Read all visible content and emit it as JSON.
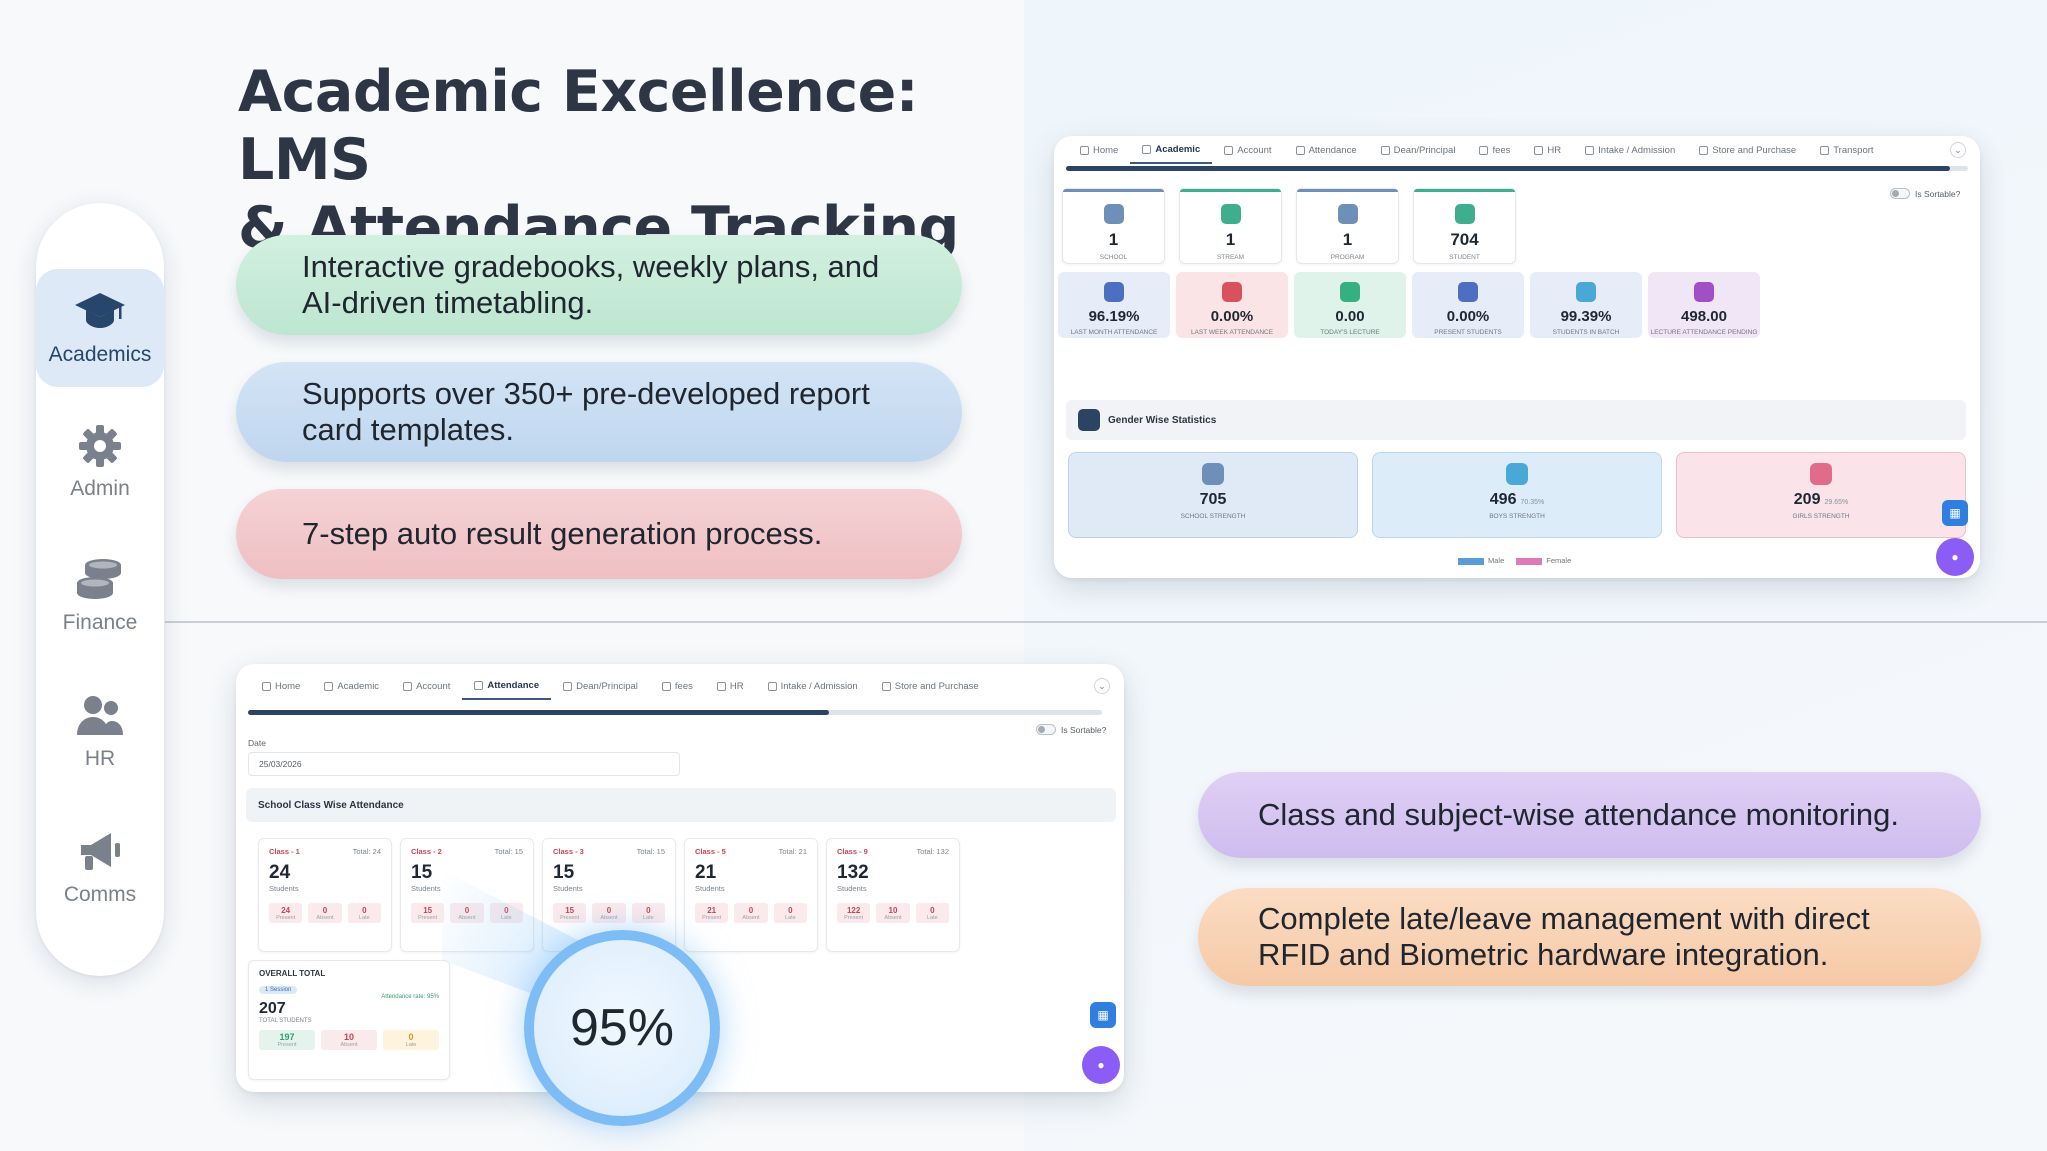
{
  "headline": {
    "line1": "Academic Excellence: LMS",
    "line2": "& Attendance Tracking"
  },
  "sidebar": {
    "items": [
      {
        "label": "Academics",
        "icon": "graduation-cap-icon",
        "active": true
      },
      {
        "label": "Admin",
        "icon": "gear-icon",
        "active": false
      },
      {
        "label": "Finance",
        "icon": "coins-icon",
        "active": false
      },
      {
        "label": "HR",
        "icon": "users-icon",
        "active": false
      },
      {
        "label": "Comms",
        "icon": "megaphone-icon",
        "active": false
      }
    ]
  },
  "features": {
    "gradebooks": {
      "line1": "Interactive gradebooks, weekly plans, and",
      "line2": "AI-driven timetabling."
    },
    "report_cards": {
      "line1": "Supports over 350+ pre-developed report",
      "line2": "card templates."
    },
    "results": "7-step auto result generation process.",
    "monitoring": "Class and subject-wise attendance monitoring.",
    "late_leave": {
      "line1": "Complete late/leave management with direct",
      "line2": "RFID and Biometric hardware integration."
    }
  },
  "dashboard": {
    "tabs": [
      "Home",
      "Academic",
      "Account",
      "Attendance",
      "Dean/Principal",
      "fees",
      "HR",
      "Intake / Admission",
      "Store and Purchase",
      "Transport"
    ],
    "active_tab": "Academic",
    "sortable_label": "Is Sortable?",
    "counts": [
      {
        "value": "1",
        "label": "School",
        "color": "#6d8fb8"
      },
      {
        "value": "1",
        "label": "Stream",
        "color": "#3fae8f"
      },
      {
        "value": "1",
        "label": "Program",
        "color": "#6d8fb8"
      },
      {
        "value": "704",
        "label": "Student",
        "color": "#3fae8f"
      }
    ],
    "stats": [
      {
        "value": "96.19%",
        "label": "Last Month Attendance",
        "bg": "#e6edf9",
        "icon_bg": "#4d6fc2"
      },
      {
        "value": "0.00%",
        "label": "Last Week Attendance",
        "bg": "#fbe4e5",
        "icon_bg": "#d8525b"
      },
      {
        "value": "0.00",
        "label": "Today's Lecture",
        "bg": "#dff3ea",
        "icon_bg": "#35b07f"
      },
      {
        "value": "0.00%",
        "label": "Present Students",
        "bg": "#e6edf9",
        "icon_bg": "#4d6fc2"
      },
      {
        "value": "99.39%",
        "label": "Students in Batch",
        "bg": "#e6edf9",
        "icon_bg": "#4aa8d6"
      },
      {
        "value": "498.00",
        "label": "Lecture Attendance Pending",
        "bg": "#f1e6f6",
        "icon_bg": "#a04fc4"
      }
    ],
    "gender_title": "Gender Wise Statistics",
    "gender": [
      {
        "value": "705",
        "suffix": "",
        "label": "School Strength",
        "bg": "#dfeaf6",
        "border": "#bdd3ec",
        "icon_bg": "#6d8fb8"
      },
      {
        "value": "496",
        "suffix": "70.35%",
        "label": "Boys Strength",
        "bg": "#dcecf8",
        "border": "#b8d9f0",
        "icon_bg": "#4aa8d6"
      },
      {
        "value": "209",
        "suffix": "29.65%",
        "label": "Girls Strength",
        "bg": "#fbe3ea",
        "border": "#f2bccb",
        "icon_bg": "#e06b8b"
      }
    ],
    "legend": [
      {
        "label": "Male",
        "color": "#5b9bd8"
      },
      {
        "label": "Female",
        "color": "#e07ab7"
      }
    ]
  },
  "attendance": {
    "tabs": [
      "Home",
      "Academic",
      "Account",
      "Attendance",
      "Dean/Principal",
      "fees",
      "HR",
      "Intake / Admission",
      "Store and Purchase"
    ],
    "active_tab": "Attendance",
    "sortable_label": "Is Sortable?",
    "date_label": "Date",
    "date_value": "25/03/2026",
    "section_title": "School Class Wise Attendance",
    "classes": [
      {
        "name": "Class - 1",
        "total": "Total: 24",
        "count": "24",
        "sub": "Students",
        "present": "24",
        "absent": "0",
        "late": "0"
      },
      {
        "name": "Class - 2",
        "total": "Total: 15",
        "count": "15",
        "sub": "Students",
        "present": "15",
        "absent": "0",
        "late": "0"
      },
      {
        "name": "Class - 3",
        "total": "Total: 15",
        "count": "15",
        "sub": "Students",
        "present": "15",
        "absent": "0",
        "late": "0"
      },
      {
        "name": "Class - 5",
        "total": "Total: 21",
        "count": "21",
        "sub": "Students",
        "present": "21",
        "absent": "0",
        "late": "0"
      },
      {
        "name": "Class - 9",
        "total": "Total: 132",
        "count": "132",
        "sub": "Students",
        "present": "122",
        "absent": "10",
        "late": "0"
      }
    ],
    "trio_labels": {
      "present": "Present",
      "absent": "Absent",
      "late": "Late"
    },
    "overall": {
      "title": "OVERALL TOTAL",
      "badge": "1 Session",
      "rate": "Attendance rate: 95%",
      "value": "207",
      "sub": "TOTAL STUDENTS",
      "present": "197",
      "absent": "10",
      "late": "0",
      "present_label": "Present",
      "absent_label": "Absent",
      "late_label": "Late"
    },
    "gauge": "95%"
  }
}
